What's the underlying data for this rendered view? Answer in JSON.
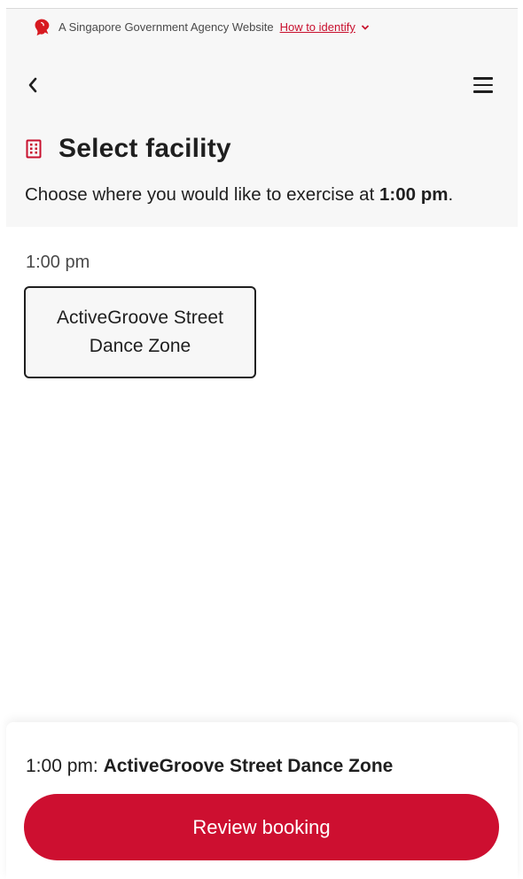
{
  "masthead": {
    "text": "A Singapore Government Agency Website",
    "identify_link": "How to identify"
  },
  "nav": {
    "back_icon": "chevron-left-icon",
    "menu_icon": "hamburger-menu-icon"
  },
  "header": {
    "title": "Select facility",
    "title_icon": "building-icon",
    "subtitle_prefix": "Choose where you would like to exercise at",
    "subtitle_time": "1:00 pm",
    "subtitle_suffix": "."
  },
  "slot": {
    "time": "1:00 pm",
    "facilities": [
      {
        "name": "ActiveGroove Street Dance Zone"
      }
    ]
  },
  "footer": {
    "summary_time": "1:00 pm:",
    "summary_facility": "ActiveGroove Street Dance Zone",
    "review_button": "Review booking"
  },
  "colors": {
    "accent": "#cd0f30",
    "header_bg": "#f7f7f7",
    "text": "#1f1f1f"
  }
}
